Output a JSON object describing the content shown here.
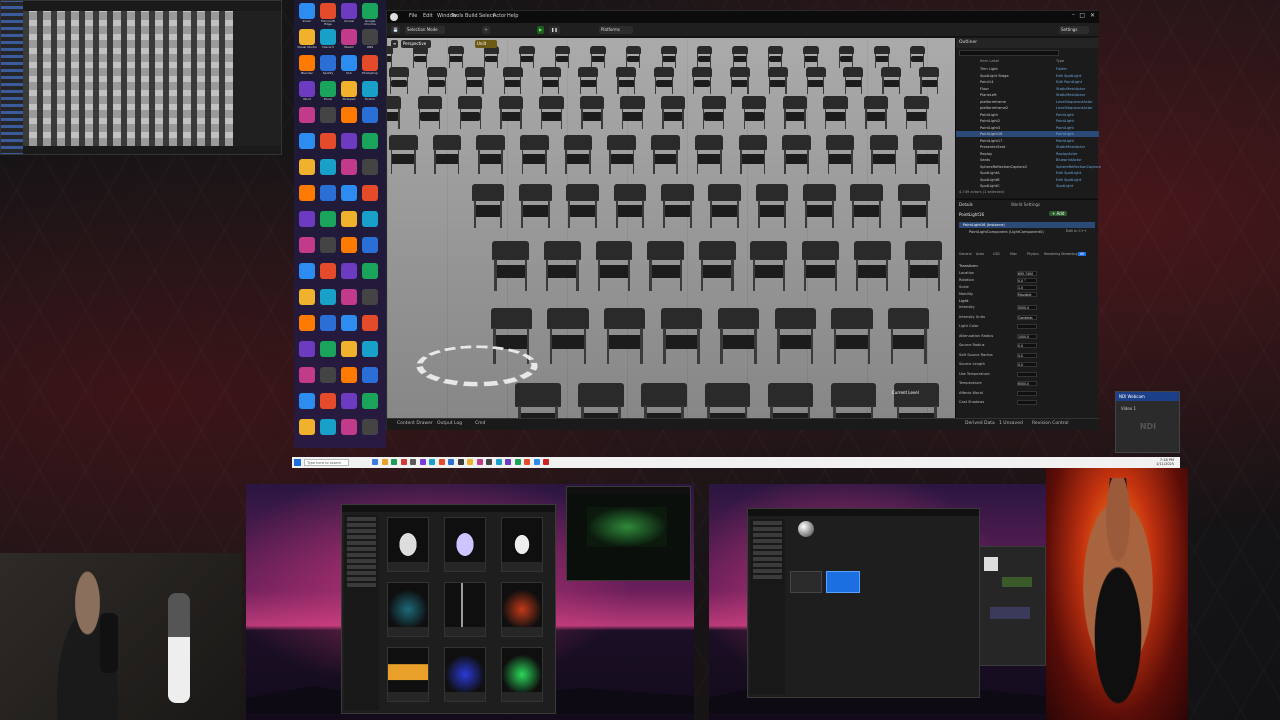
{
  "editor": {
    "menu": [
      "File",
      "Edit",
      "Window",
      "Tools",
      "Build",
      "Select",
      "Actor",
      "Help"
    ],
    "toolbar": {
      "mode_label": "Selection Mode",
      "platforms_label": "Platforms",
      "settings_label": "Settings"
    },
    "viewport": {
      "view_mode": "Perspective",
      "lighting_mode": "Unlit",
      "current_level_label": "Current Level"
    },
    "bottom_tabs": [
      "Content Drawer",
      "Output Log",
      "Cmd"
    ],
    "status": {
      "derived_data": "Derived Data",
      "unsaved": "1 Unsaved",
      "revision_control": "Revision Control"
    }
  },
  "outliner": {
    "title": "Outliner",
    "columns": [
      "Item Label",
      "Type"
    ],
    "rows": [
      {
        "name": "Trim Light",
        "type": "Folder"
      },
      {
        "name": "SpotLight Stage",
        "type": "Edit SpotLight"
      },
      {
        "name": "Point14",
        "type": "Edit PointLight"
      },
      {
        "name": "Floor",
        "type": "StaticMeshActor"
      },
      {
        "name": "PlaneLeft",
        "type": "StaticMeshActor"
      },
      {
        "name": "platformframe",
        "type": "LevelSequenceActor"
      },
      {
        "name": "platformframe2",
        "type": "LevelSequenceActor"
      },
      {
        "name": "PointLight",
        "type": "PointLight"
      },
      {
        "name": "PointLight2",
        "type": "PointLight"
      },
      {
        "name": "PointLight3",
        "type": "PointLight"
      },
      {
        "name": "PointLight16",
        "type": "PointLight"
      },
      {
        "name": "PointLight17",
        "type": "PointLight"
      },
      {
        "name": "PresenterSeat",
        "type": "StaticMeshActor"
      },
      {
        "name": "Replay",
        "type": "ReplayActor"
      },
      {
        "name": "Seats",
        "type": "BlueprintActor"
      },
      {
        "name": "SphereReflectionCapture2",
        "type": "SphereReflectionCapture"
      },
      {
        "name": "SpotLightA",
        "type": "Edit SpotLight"
      },
      {
        "name": "SpotLightB",
        "type": "Edit SpotLight"
      },
      {
        "name": "SpotLightC",
        "type": "SpotLight"
      }
    ],
    "footer": "4,749 actors (1 selected)"
  },
  "details": {
    "tabs": [
      "Details",
      "World Settings"
    ],
    "actor_name": "PointLight16",
    "add_label": "+ Add",
    "components": [
      "PointLight16 (Instance)",
      "PointLightComponent (LightComponent0)"
    ],
    "edit_cpp_label": "Edit in C++",
    "filters": [
      "General",
      "Actor",
      "LOD",
      "Misc",
      "Physics",
      "Rendering",
      "Streaming",
      "All"
    ],
    "sections": [
      "Transform",
      "Light"
    ],
    "rows": [
      {
        "label": "Location",
        "value": "695.7400"
      },
      {
        "label": "Rotation",
        "value": "0.0 °"
      },
      {
        "label": "Scale",
        "value": "1.0"
      },
      {
        "label": "Mobility",
        "value": "Movable"
      },
      {
        "label": "Intensity",
        "value": "5000.0"
      },
      {
        "label": "Intensity Units",
        "value": "Candelas"
      },
      {
        "label": "Light Color",
        "value": ""
      },
      {
        "label": "Attenuation Radius",
        "value": "1000.0"
      },
      {
        "label": "Source Radius",
        "value": "0.0"
      },
      {
        "label": "Soft Source Radius",
        "value": "0.0"
      },
      {
        "label": "Source Length",
        "value": "0.0"
      },
      {
        "label": "Use Temperature",
        "value": ""
      },
      {
        "label": "Temperature",
        "value": "6500.0"
      },
      {
        "label": "Affects World",
        "value": ""
      },
      {
        "label": "Cast Shadows",
        "value": ""
      }
    ]
  },
  "taskbar": {
    "search_placeholder": "Type here to search",
    "time": "7:18 PM",
    "date": "1/11/2025"
  },
  "ndi": {
    "title": "NDI Webcam",
    "video_label": "Video 1",
    "logo": "NDI"
  },
  "desktop": {
    "icons": [
      "Zoom",
      "Microsoft Edge",
      "Unreal",
      "Google Chrome",
      "Visual Studio",
      "Discord",
      "Steam",
      "OBS",
      "Blender",
      "Spotify",
      "VLC",
      "Photoshop",
      "Word",
      "Excel",
      "Notepad",
      "Firefox"
    ]
  },
  "colors": {
    "editor_bg": "#151515",
    "selection_blue": "#2c4a78",
    "accent_blue": "#1c6fe0",
    "taskbar": "#f1f1f1"
  }
}
